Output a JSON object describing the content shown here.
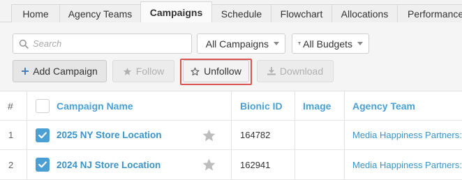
{
  "tabs": [
    {
      "label": "Home"
    },
    {
      "label": "Agency Teams"
    },
    {
      "label": "Campaigns",
      "active": true
    },
    {
      "label": "Schedule"
    },
    {
      "label": "Flowchart"
    },
    {
      "label": "Allocations"
    },
    {
      "label": "Performance"
    }
  ],
  "search": {
    "placeholder": "Search",
    "value": ""
  },
  "filters": {
    "campaigns_label": "All Campaigns",
    "budgets_label": "All Budgets"
  },
  "actions": {
    "add_label": "Add Campaign",
    "follow_label": "Follow",
    "unfollow_label": "Unfollow",
    "download_label": "Download"
  },
  "table": {
    "columns": {
      "index": "#",
      "name": "Campaign Name",
      "bionic_id": "Bionic ID",
      "image": "Image",
      "agency_team": "Agency Team"
    },
    "rows": [
      {
        "index": "1",
        "name": "2025 NY Store Location",
        "bionic_id": "164782",
        "image": "",
        "agency_team": "Media Happiness Partners:",
        "checked": true
      },
      {
        "index": "2",
        "name": "2024 NJ Store Location",
        "bionic_id": "162941",
        "image": "",
        "agency_team": "Media Happiness Partners:",
        "checked": true
      }
    ]
  },
  "colors": {
    "accent": "#4a9fd5",
    "highlight_border": "#d9534f"
  }
}
